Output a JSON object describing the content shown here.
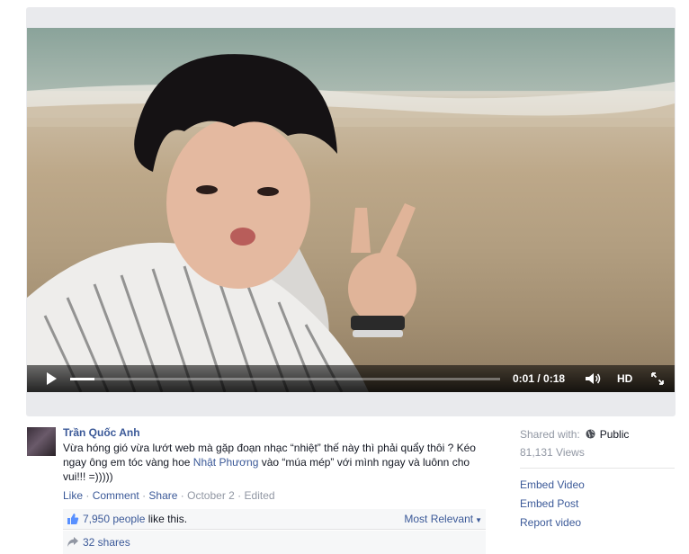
{
  "video": {
    "time_display": "0:01 / 0:18",
    "progress": 0.056,
    "hd_label": "HD",
    "icons": {
      "play": "play-icon",
      "volume": "volume-icon",
      "fullscreen": "fullscreen-icon"
    }
  },
  "post": {
    "author": "Trần Quốc Anh",
    "text_before": "Vừa hóng gió vừa lướt web mà gặp đoạn nhạc “nhiệt” thế này thì phải quẩy thôi ? Kéo ngay ông em tóc vàng hoe ",
    "mention": "Nhật Phương",
    "text_after": " vào “múa mép” với mình ngay và luônn cho vui!!! =)))))",
    "actions": {
      "like": "Like",
      "comment": "Comment",
      "share": "Share",
      "date": "October 2",
      "edited": "Edited"
    },
    "likes": {
      "count_text": "7,950 people",
      "suffix": " like this.",
      "sort_label": "Most Relevant"
    },
    "shares": "32 shares"
  },
  "sidebar": {
    "shared_with_label": "Shared with:",
    "audience": "Public",
    "views": "81,131 Views",
    "links": [
      "Embed Video",
      "Embed Post",
      "Report video"
    ]
  },
  "colors": {
    "link": "#3b5998",
    "muted": "#9197a3",
    "panel": "#f6f7f8"
  }
}
